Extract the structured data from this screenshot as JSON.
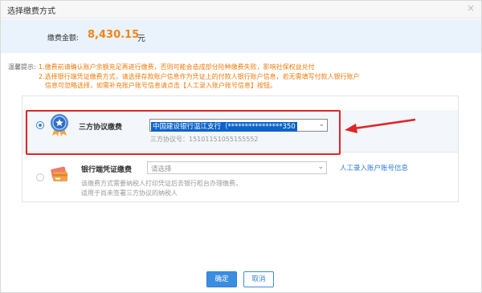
{
  "dialog": {
    "title": "选择缴费方式",
    "close_glyph": "×"
  },
  "amount": {
    "label": "缴费金额:",
    "value": "8,430.15",
    "unit": "元"
  },
  "tips": {
    "heading": "温馨提示:",
    "line1": "1.缴费前请确认账户余额充足再进行缴费，否则可能会造成部分险种缴费失败，影响社保权益兑付",
    "line2": "2.选择银行端凭证缴费方式，请选择存款账户信息作为凭证上的付款人银行账户信息，若无需填写付款人银行账户",
    "line3": "信息可忽略选择，如需补充账户账号信息请点击【人工录入账户账号信息】按钮。"
  },
  "options": [
    {
      "title": "三方协议缴费",
      "selected": true,
      "icon": "award-badge-icon",
      "select_value": "中国建设银行温江支行（****************350",
      "sub": "三方协议号：15101151055155552"
    },
    {
      "title": "银行端凭证缴费",
      "selected": false,
      "icon": "credit-card-icon",
      "select_placeholder": "请选择",
      "link": "人工录入账户账号信息",
      "sub1": "该缴费方式需要纳税人打印凭证后去银行柜台办理缴费，",
      "sub2": "适用于尚未签署三方协议的纳税人"
    }
  ],
  "buttons": {
    "ok": "确定",
    "cancel": "取消"
  },
  "colors": {
    "accent": "#3b8de0",
    "amount": "#f08519",
    "tips": "#f07a0a",
    "annotation": "#e02525"
  }
}
